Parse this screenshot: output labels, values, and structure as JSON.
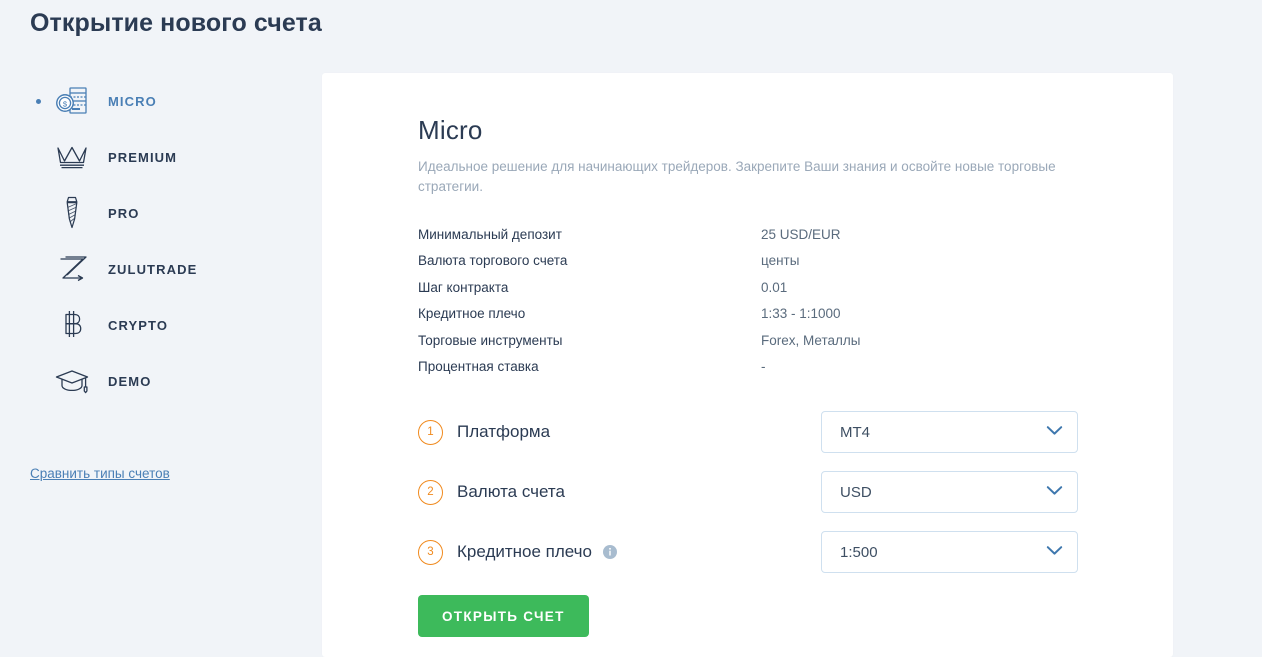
{
  "page": {
    "title": "Открытие нового счета"
  },
  "sidebar": {
    "items": [
      {
        "label": "MICRO",
        "icon": "coin-stack-icon",
        "active": true
      },
      {
        "label": "PREMIUM",
        "icon": "crown-icon",
        "active": false
      },
      {
        "label": "PRO",
        "icon": "necktie-icon",
        "active": false
      },
      {
        "label": "ZULUTRADE",
        "icon": "zulutrade-z-icon",
        "active": false
      },
      {
        "label": "CRYPTO",
        "icon": "bitcoin-icon",
        "active": false
      },
      {
        "label": "DEMO",
        "icon": "graduation-cap-icon",
        "active": false
      }
    ],
    "compare_link": "Сравнить типы счетов"
  },
  "card": {
    "plan_title": "Micro",
    "plan_description": "Идеальное решение для начинающих трейдеров. Закрепите Ваши знания и освойте новые торговые стратегии.",
    "specs": [
      {
        "key": "Минимальный депозит",
        "value": "25 USD/EUR"
      },
      {
        "key": "Валюта торгового счета",
        "value": "центы"
      },
      {
        "key": "Шаг контракта",
        "value": "0.01"
      },
      {
        "key": "Кредитное плечо",
        "value": "1:33 - 1:1000"
      },
      {
        "key": "Торговые инструменты",
        "value": "Forex, Металлы"
      },
      {
        "key": "Процентная ставка",
        "value": "-"
      }
    ],
    "form": {
      "rows": [
        {
          "step": "1",
          "label": "Платформа",
          "value": "MT4",
          "has_info": false
        },
        {
          "step": "2",
          "label": "Валюта счета",
          "value": "USD",
          "has_info": false
        },
        {
          "step": "3",
          "label": "Кредитное плечо",
          "value": "1:500",
          "has_info": true
        }
      ],
      "submit_label": "ОТКРЫТЬ СЧЕТ"
    }
  },
  "colors": {
    "page_bg": "#f1f4f8",
    "card_bg": "#ffffff",
    "navy": "#2b3b53",
    "link_blue": "#4a7fb5",
    "accent_orange": "#f08a1e",
    "success_green": "#3dba5b",
    "muted_text": "#9aa8b8",
    "border_blue": "#cfe0ef"
  }
}
